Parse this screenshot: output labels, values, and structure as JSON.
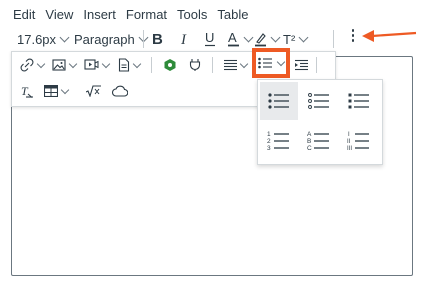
{
  "menubar": {
    "items": [
      "Edit",
      "View",
      "Insert",
      "Format",
      "Tools",
      "Table"
    ]
  },
  "toolbar": {
    "font_size": "17.6px",
    "block_format": "Paragraph",
    "superscript_label": "T²"
  },
  "colors": {
    "highlight_border": "#ee5a24",
    "arrow": "#ee5a24",
    "text": "#2d3b45"
  },
  "list_styles": [
    {
      "name": "default",
      "selected": true
    },
    {
      "name": "circle",
      "selected": false
    },
    {
      "name": "square",
      "selected": false
    },
    {
      "name": "decimal",
      "selected": false
    },
    {
      "name": "upper-alpha",
      "selected": false
    },
    {
      "name": "upper-roman",
      "selected": false
    }
  ],
  "list_number_labels": {
    "decimal": [
      "1",
      "2",
      "3"
    ],
    "upper_alpha": [
      "A",
      "B",
      "C"
    ],
    "upper_roman": [
      "I",
      "II",
      "III"
    ]
  }
}
